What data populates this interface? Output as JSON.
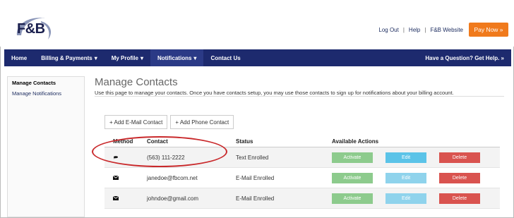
{
  "brand": {
    "logo_text": "F&B"
  },
  "header": {
    "links": [
      "Log Out",
      "Help",
      "F&B Website"
    ],
    "separator": "|",
    "pay_button": "Pay Now »"
  },
  "nav": {
    "items": [
      {
        "label": "Home",
        "dropdown": false
      },
      {
        "label": "Billing & Payments",
        "dropdown": true
      },
      {
        "label": "My Profile",
        "dropdown": true
      },
      {
        "label": "Notifications",
        "dropdown": true
      },
      {
        "label": "Contact Us",
        "dropdown": false
      }
    ],
    "help_text": "Have a Question? Get Help. »"
  },
  "sidebar": {
    "items": [
      "Manage Contacts",
      "Manage Notifications"
    ]
  },
  "main": {
    "title": "Manage Contacts",
    "description": "Use this page to manage your contacts. Once you have contacts setup, you may use those contacts to sign up for notifications about your billing account.",
    "add_email": "+ Add E-Mail Contact",
    "add_phone": "+ Add Phone Contact"
  },
  "table": {
    "headers": [
      "Method",
      "Contact",
      "Status",
      "Available Actions"
    ],
    "rows": [
      {
        "method_icon": "chat-icon",
        "contact": "(563) 111-2222",
        "status": "Text Enrolled"
      },
      {
        "method_icon": "envelope-icon",
        "contact": "janedoe@fbcom.net",
        "status": "E-Mail Enrolled"
      },
      {
        "method_icon": "envelope-icon",
        "contact": "johndoe@gmail.com",
        "status": "E-Mail Enrolled"
      }
    ],
    "actions": [
      "Activate",
      "Edit",
      "Delete"
    ]
  },
  "colors": {
    "nav_bg": "#1d2a6e",
    "pay_button": "#f07a1c",
    "activate": "#8dcb8d",
    "edit": "#5bc3e8",
    "delete": "#d9534f",
    "highlight_ellipse": "#c9292b"
  }
}
